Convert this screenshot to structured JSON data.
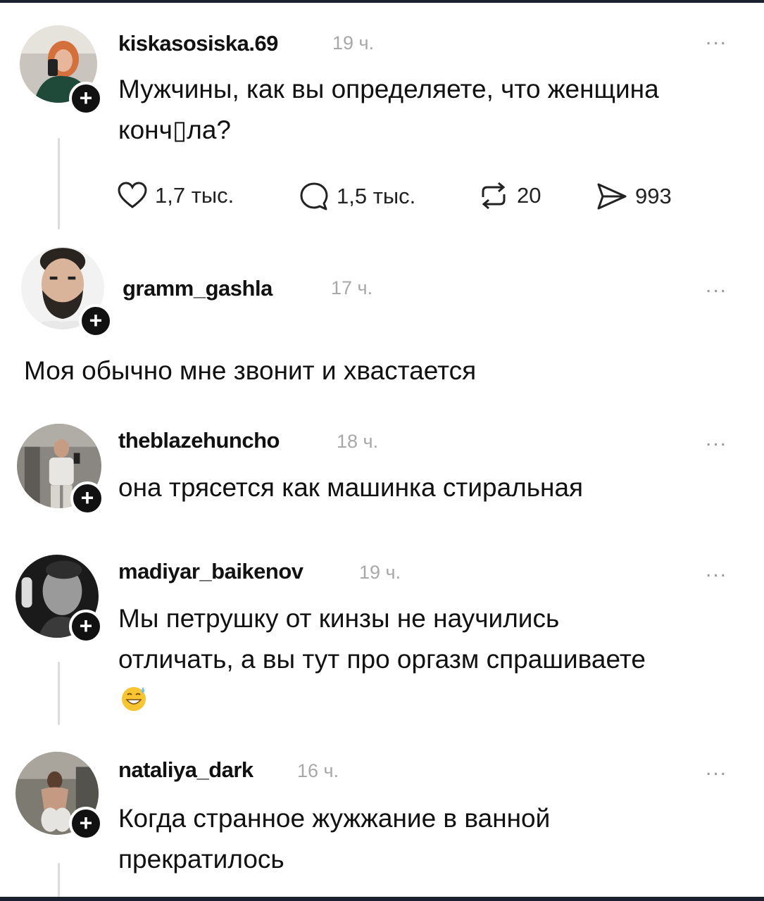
{
  "posts": [
    {
      "username": "kiskasosiska.69",
      "time": "19 ч.",
      "more": "...",
      "text_line1": "Мужчины, как вы определяете, что женщина",
      "text_line2": "конч▯ла?",
      "follow": "+",
      "avatar": "woman-selfie-avatar"
    },
    {
      "username": "gramm_gashla",
      "time": "17 ч.",
      "more": "...",
      "text": "Моя обычно мне звонит и хвастается",
      "follow": "+",
      "avatar": "man-beard-avatar"
    },
    {
      "username": "theblazehuncho",
      "time": "18 ч.",
      "more": "...",
      "text": "она трясется как машинка стиральная",
      "follow": "+",
      "avatar": "man-mirror-selfie-avatar"
    },
    {
      "username": "madiyar_baikenov",
      "time": "19 ч.",
      "more": "...",
      "text_line1": "Мы петрушку от кинзы не научились",
      "text_line2": "отличать, а вы тут про оргазм спрашиваете",
      "emoji": "grinning-sweat-emoji",
      "follow": "+",
      "avatar": "man-bw-portrait-avatar"
    },
    {
      "username": "nataliya_dark",
      "time": "16 ч.",
      "more": "...",
      "text_line1": "Когда странное жужжание в ванной",
      "text_line2": "прекратилось",
      "follow": "+",
      "avatar": "woman-gym-mirror-avatar"
    }
  ],
  "actions": {
    "likes": "1,7 тыс.",
    "replies": "1,5 тыс.",
    "reposts": "20",
    "shares": "993"
  },
  "colors": {
    "text": "#111111",
    "muted": "#a8a8a8",
    "thread": "#dcdcdc",
    "frame": "#1c2130"
  }
}
